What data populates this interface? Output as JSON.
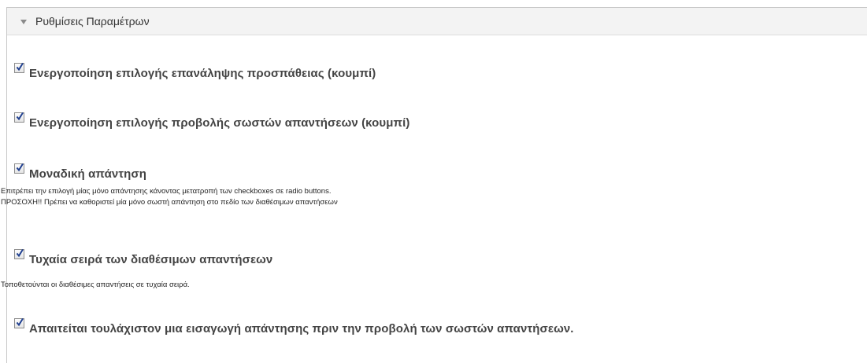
{
  "section": {
    "title": "Ρυθμίσεις Παραμέτρων",
    "toggle_icon": "triangle-down-icon"
  },
  "options": [
    {
      "label": "Ενεργοποίηση επιλογής επανάληψης προσπάθειας (κουμπί)",
      "checked": true,
      "description": []
    },
    {
      "label": "Ενεργοποίηση επιλογής προβολής σωστών απαντήσεων (κουμπί)",
      "checked": true,
      "description": []
    },
    {
      "label": "Μοναδική απάντηση",
      "checked": true,
      "description": [
        "Επιτρέπει την επιλογή μίας μόνο απάντησης κάνοντας μετατροπή των checkboxes σε radio buttons.",
        "ΠΡΟΣΟΧΗ!! Πρέπει να καθοριστεί μία μόνο σωστή απάντηση στο πεδίο των διαθέσιμων απαντήσεων"
      ]
    },
    {
      "label": "Τυχαία σειρά των διαθέσιμων απαντήσεων",
      "checked": true,
      "description": [
        "Τοποθετούνται οι διαθέσιμες απαντήσεις σε τυχαία σειρά."
      ]
    },
    {
      "label": "Απαιτείται τουλάχιστον μια εισαγωγή απάντησης πριν την προβολή των σωστών απαντήσεων.",
      "checked": true,
      "description": []
    }
  ]
}
